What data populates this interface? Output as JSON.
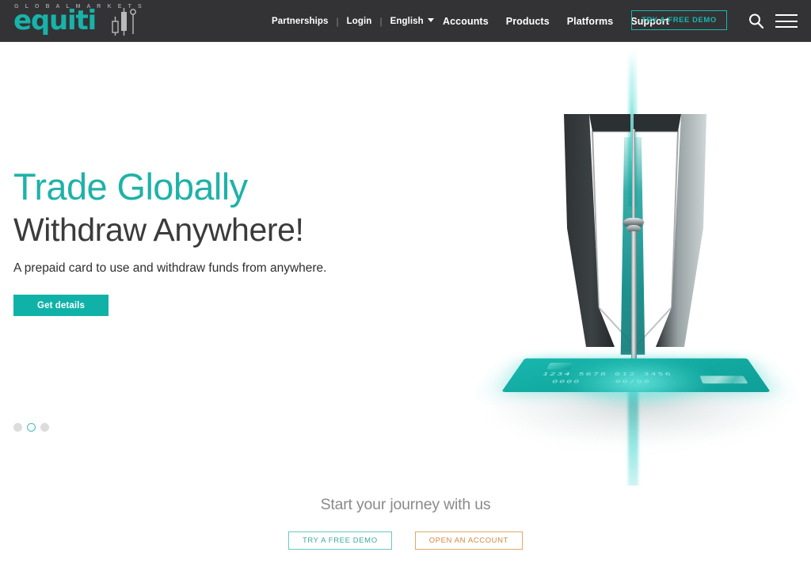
{
  "brand": {
    "accent_teal": "#17b3aa",
    "accent_orange": "#d4883c",
    "header_bg": "#333335",
    "logo_tagline": "G L O B A L   M A R K E T S",
    "logo_name": "equiti"
  },
  "header": {
    "secondary_nav": [
      {
        "label": "Partnerships",
        "name": "partnerships"
      },
      {
        "label": "Login",
        "name": "login"
      },
      {
        "label": "English",
        "name": "language"
      }
    ],
    "separator": "|",
    "language_caret": "chevron-down-icon",
    "main_nav": [
      {
        "label": "Accounts",
        "name": "accounts"
      },
      {
        "label": "Products",
        "name": "products"
      },
      {
        "label": "Platforms",
        "name": "platforms"
      },
      {
        "label": "Support",
        "name": "support"
      }
    ],
    "demo_button": "TRY A FREE DEMO",
    "search_icon": "search-icon",
    "menu_icon": "hamburger-menu-icon"
  },
  "hero": {
    "title_line_1": "Trade Globally",
    "title_line_2": "Withdraw Anywhere!",
    "subtitle": "A prepaid card to use and withdraw funds from anywhere.",
    "cta_label": "Get details",
    "carousel": {
      "total": 3,
      "active_index": 2,
      "dots": [
        "slide-1",
        "slide-2",
        "slide-3"
      ]
    },
    "artwork": {
      "alt": "teal prepaid card with tower and arch monument",
      "card_number": "1234 5678 012 3456",
      "card_code": "0000",
      "card_expiry": "00/00"
    }
  },
  "bottom_cta": {
    "heading": "Start your journey with us",
    "demo_button": "TRY A FREE DEMO",
    "account_button": "OPEN AN ACCOUNT"
  }
}
